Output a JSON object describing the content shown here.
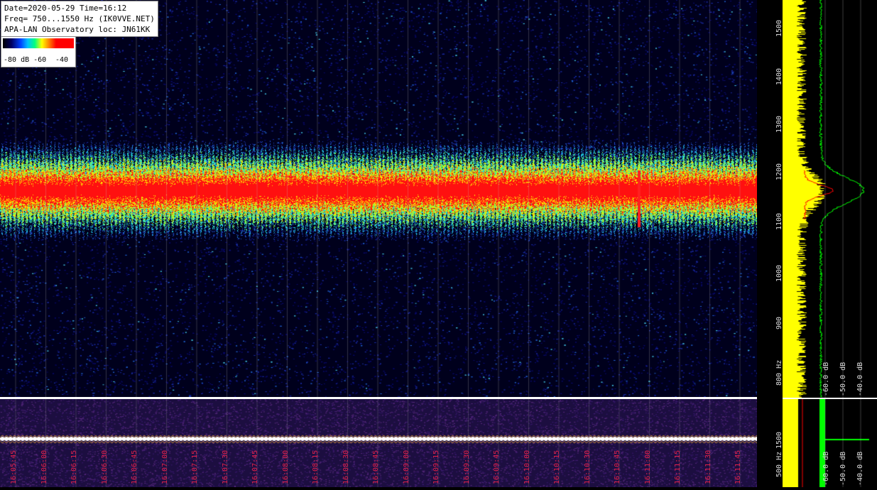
{
  "info": {
    "line1": "Date=2020-05-29 Time=16:12",
    "line2": "Freq= 750...1550 Hz (IK0VVE.NET)",
    "line3": "APA-LAN Observatory loc: JN61KK"
  },
  "legend": {
    "label_a": "-80 dB -60",
    "label_b": "-40"
  },
  "freq_ticks": [
    "1500",
    "1400",
    "1300",
    "1200",
    "1100",
    "1000",
    "900",
    "800 Hz"
  ],
  "lower_freq_ticks": [
    "1500",
    "500 Hz"
  ],
  "db_labels": [
    "-60.0 dB",
    "-50.0 dB",
    "-40.0 dB"
  ],
  "lower_db_labels": [
    "-60.0 dB",
    "-50.0 dB",
    "-40.0 dB"
  ],
  "time_labels": [
    "16:05:45",
    "16:06:00",
    "16:06:15",
    "16:06:30",
    "16:06:45",
    "16:07:00",
    "16:07:15",
    "16:07:30",
    "16:07:45",
    "16:08:00",
    "16:08:15",
    "16:08:30",
    "16:08:45",
    "16:09:00",
    "16:09:15",
    "16:09:30",
    "16:09:45",
    "16:10:00",
    "16:10:15",
    "16:10:30",
    "16:10:45",
    "16:11:00",
    "16:11:15",
    "16:11:30",
    "16:11:45"
  ],
  "colors": {
    "background": "#00001c",
    "time_label": "#e0204a",
    "spectrum_yellow": "#ffff00",
    "spectrum_green": "#00ff00",
    "spectrum_red": "#ff0000"
  }
}
